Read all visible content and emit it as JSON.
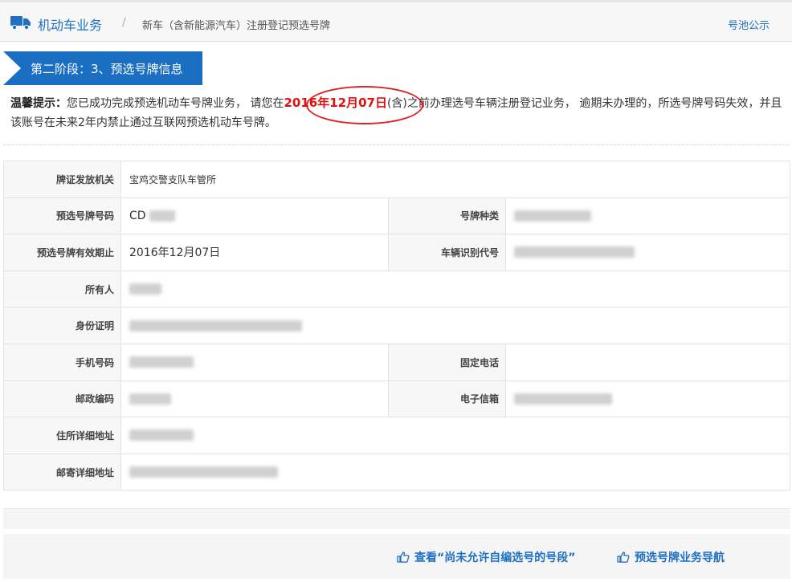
{
  "header": {
    "section": "机动车业务",
    "separator": "/",
    "page": "新车（含新能源汽车）注册登记预选号牌",
    "pool_link": "号池公示"
  },
  "stage": {
    "label": "第二阶段：3、预选号牌信息"
  },
  "notice": {
    "lead": "温馨提示：",
    "text1": "您已成功完成预选机动车号牌业务， 请您在",
    "date": "2016年12月07日",
    "text2": "(含)之前办理选号车辆注册登记业务， 逾期未办理的，所选号牌号码失效，并且该账号在未来2年内禁止通过互联网预选机动车号牌。"
  },
  "table": {
    "issuer_label": "牌证发放机关",
    "issuer_value": "宝鸡交警支队车管所",
    "plate_label": "预选号牌号码",
    "plate_value": "CD",
    "plate_type_label": "号牌种类",
    "expiry_label": "预选号牌有效期止",
    "expiry_value": "2016年12月07日",
    "vin_label": "车辆识别代号",
    "owner_label": "所有人",
    "id_label": "身份证明",
    "mobile_label": "手机号码",
    "landline_label": "固定电话",
    "postcode_label": "邮政编码",
    "email_label": "电子信箱",
    "address_label": "住所详细地址",
    "mail_address_label": "邮寄详细地址"
  },
  "footer": {
    "link1": "查看“尚未允许自编选号的号段”",
    "link2": "预选号牌业务导航"
  },
  "colors": {
    "accent": "#1a6fc2",
    "alert": "#e01010"
  }
}
